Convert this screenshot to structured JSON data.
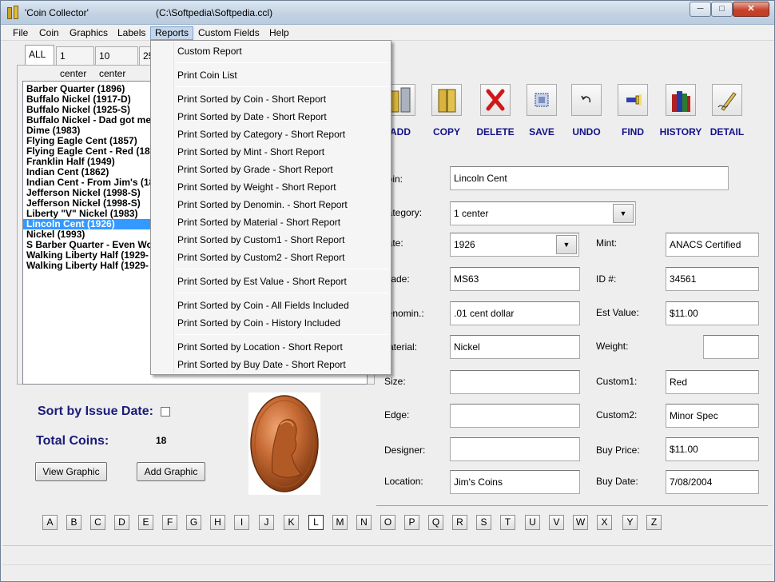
{
  "window": {
    "title": "'Coin Collector'",
    "file_path": "(C:\\Softpedia\\Softpedia.ccl)",
    "minimize_glyph": "─",
    "maximize_glyph": "□",
    "close_glyph": "✕"
  },
  "menu": [
    "File",
    "Coin",
    "Graphics",
    "Labels",
    "Reports",
    "Custom Fields",
    "Help"
  ],
  "tabs": [
    "ALL",
    "1 center",
    "10 center",
    "25"
  ],
  "coins": [
    "Barber Quarter (1896)",
    "Buffalo Nickel (1917-D)",
    "Buffalo Nickel (1925-S)",
    "Buffalo Nickel - Dad got me",
    "Dime (1983)",
    "Flying Eagle Cent (1857)",
    "Flying Eagle Cent - Red (18",
    "Franklin Half (1949)",
    "Indian Cent (1862)",
    "Indian Cent - From Jim's (18",
    "Jefferson Nickel (1998-S)",
    "Jefferson Nickel (1998-S)",
    "Liberty \"V\" Nickel (1983)",
    "Lincoln Cent (1926)",
    "Nickel (1993)",
    "S Barber Quarter - Even Wo",
    "Walking Liberty Half (1929-",
    "Walking Liberty Half (1929-"
  ],
  "left_panel": {
    "sort_label": "Sort by Issue Date:",
    "total_label": "Total Coins:",
    "total_value": "18",
    "view_graphic": "View Graphic",
    "add_graphic": "Add Graphic"
  },
  "toolbar": [
    "ADD",
    "COPY",
    "DELETE",
    "SAVE",
    "UNDO",
    "FIND",
    "HISTORY",
    "DETAIL"
  ],
  "form": {
    "coin_label": "Coin:",
    "coin_value": "Lincoln Cent",
    "category_label": "Category:",
    "category_value": "1 center",
    "date_label": "Date:",
    "date_value": "1926",
    "mint_label": "Mint:",
    "mint_value": "ANACS Certified",
    "grade_label": "Grade:",
    "grade_value": "MS63",
    "id_label": "ID #:",
    "id_value": "34561",
    "denomin_label": "Denomin.:",
    "denomin_value": ".01 cent dollar",
    "estvalue_label": "Est Value:",
    "estvalue_value": "$11.00",
    "material_label": "Material:",
    "material_value": "Nickel",
    "weight_label": "Weight:",
    "weight_value": "",
    "size_label": "Size:",
    "size_value": "",
    "custom1_label": "Custom1:",
    "custom1_value": "Red",
    "edge_label": "Edge:",
    "edge_value": "",
    "custom2_label": "Custom2:",
    "custom2_value": "Minor Spec",
    "designer_label": "Designer:",
    "designer_value": "",
    "buyprice_label": "Buy Price:",
    "buyprice_value": "$11.00",
    "location_label": "Location:",
    "location_value": "Jim's Coins",
    "buydate_label": "Buy Date:",
    "buydate_value": "7/08/2004"
  },
  "alphabet": [
    "A",
    "B",
    "C",
    "D",
    "E",
    "F",
    "G",
    "H",
    "I",
    "J",
    "K",
    "L",
    "M",
    "N",
    "O",
    "P",
    "Q",
    "R",
    "S",
    "T",
    "U",
    "V",
    "W",
    "X",
    "Y",
    "Z"
  ],
  "reports_menu": [
    "Custom Report",
    "Print Coin List",
    "Print Sorted by Coin - Short Report",
    "Print Sorted by Date - Short Report",
    "Print Sorted by Category - Short Report",
    "Print Sorted by Mint - Short Report",
    "Print Sorted by Grade - Short Report",
    "Print Sorted by Weight - Short Report",
    "Print Sorted by Denomin. - Short Report",
    "Print Sorted by Material - Short Report",
    "Print Sorted by Custom1 - Short Report",
    "Print Sorted by Custom2 - Short Report",
    "Print Sorted by Est Value - Short Report",
    "Print Sorted by Coin - All Fields Included",
    "Print Sorted by Coin - History Included",
    "Print Sorted by Location - Short Report",
    "Print Sorted by Buy Date - Short Report"
  ],
  "colors": {
    "accent": "#3399ff",
    "label_blue": "#1b1b7a"
  }
}
